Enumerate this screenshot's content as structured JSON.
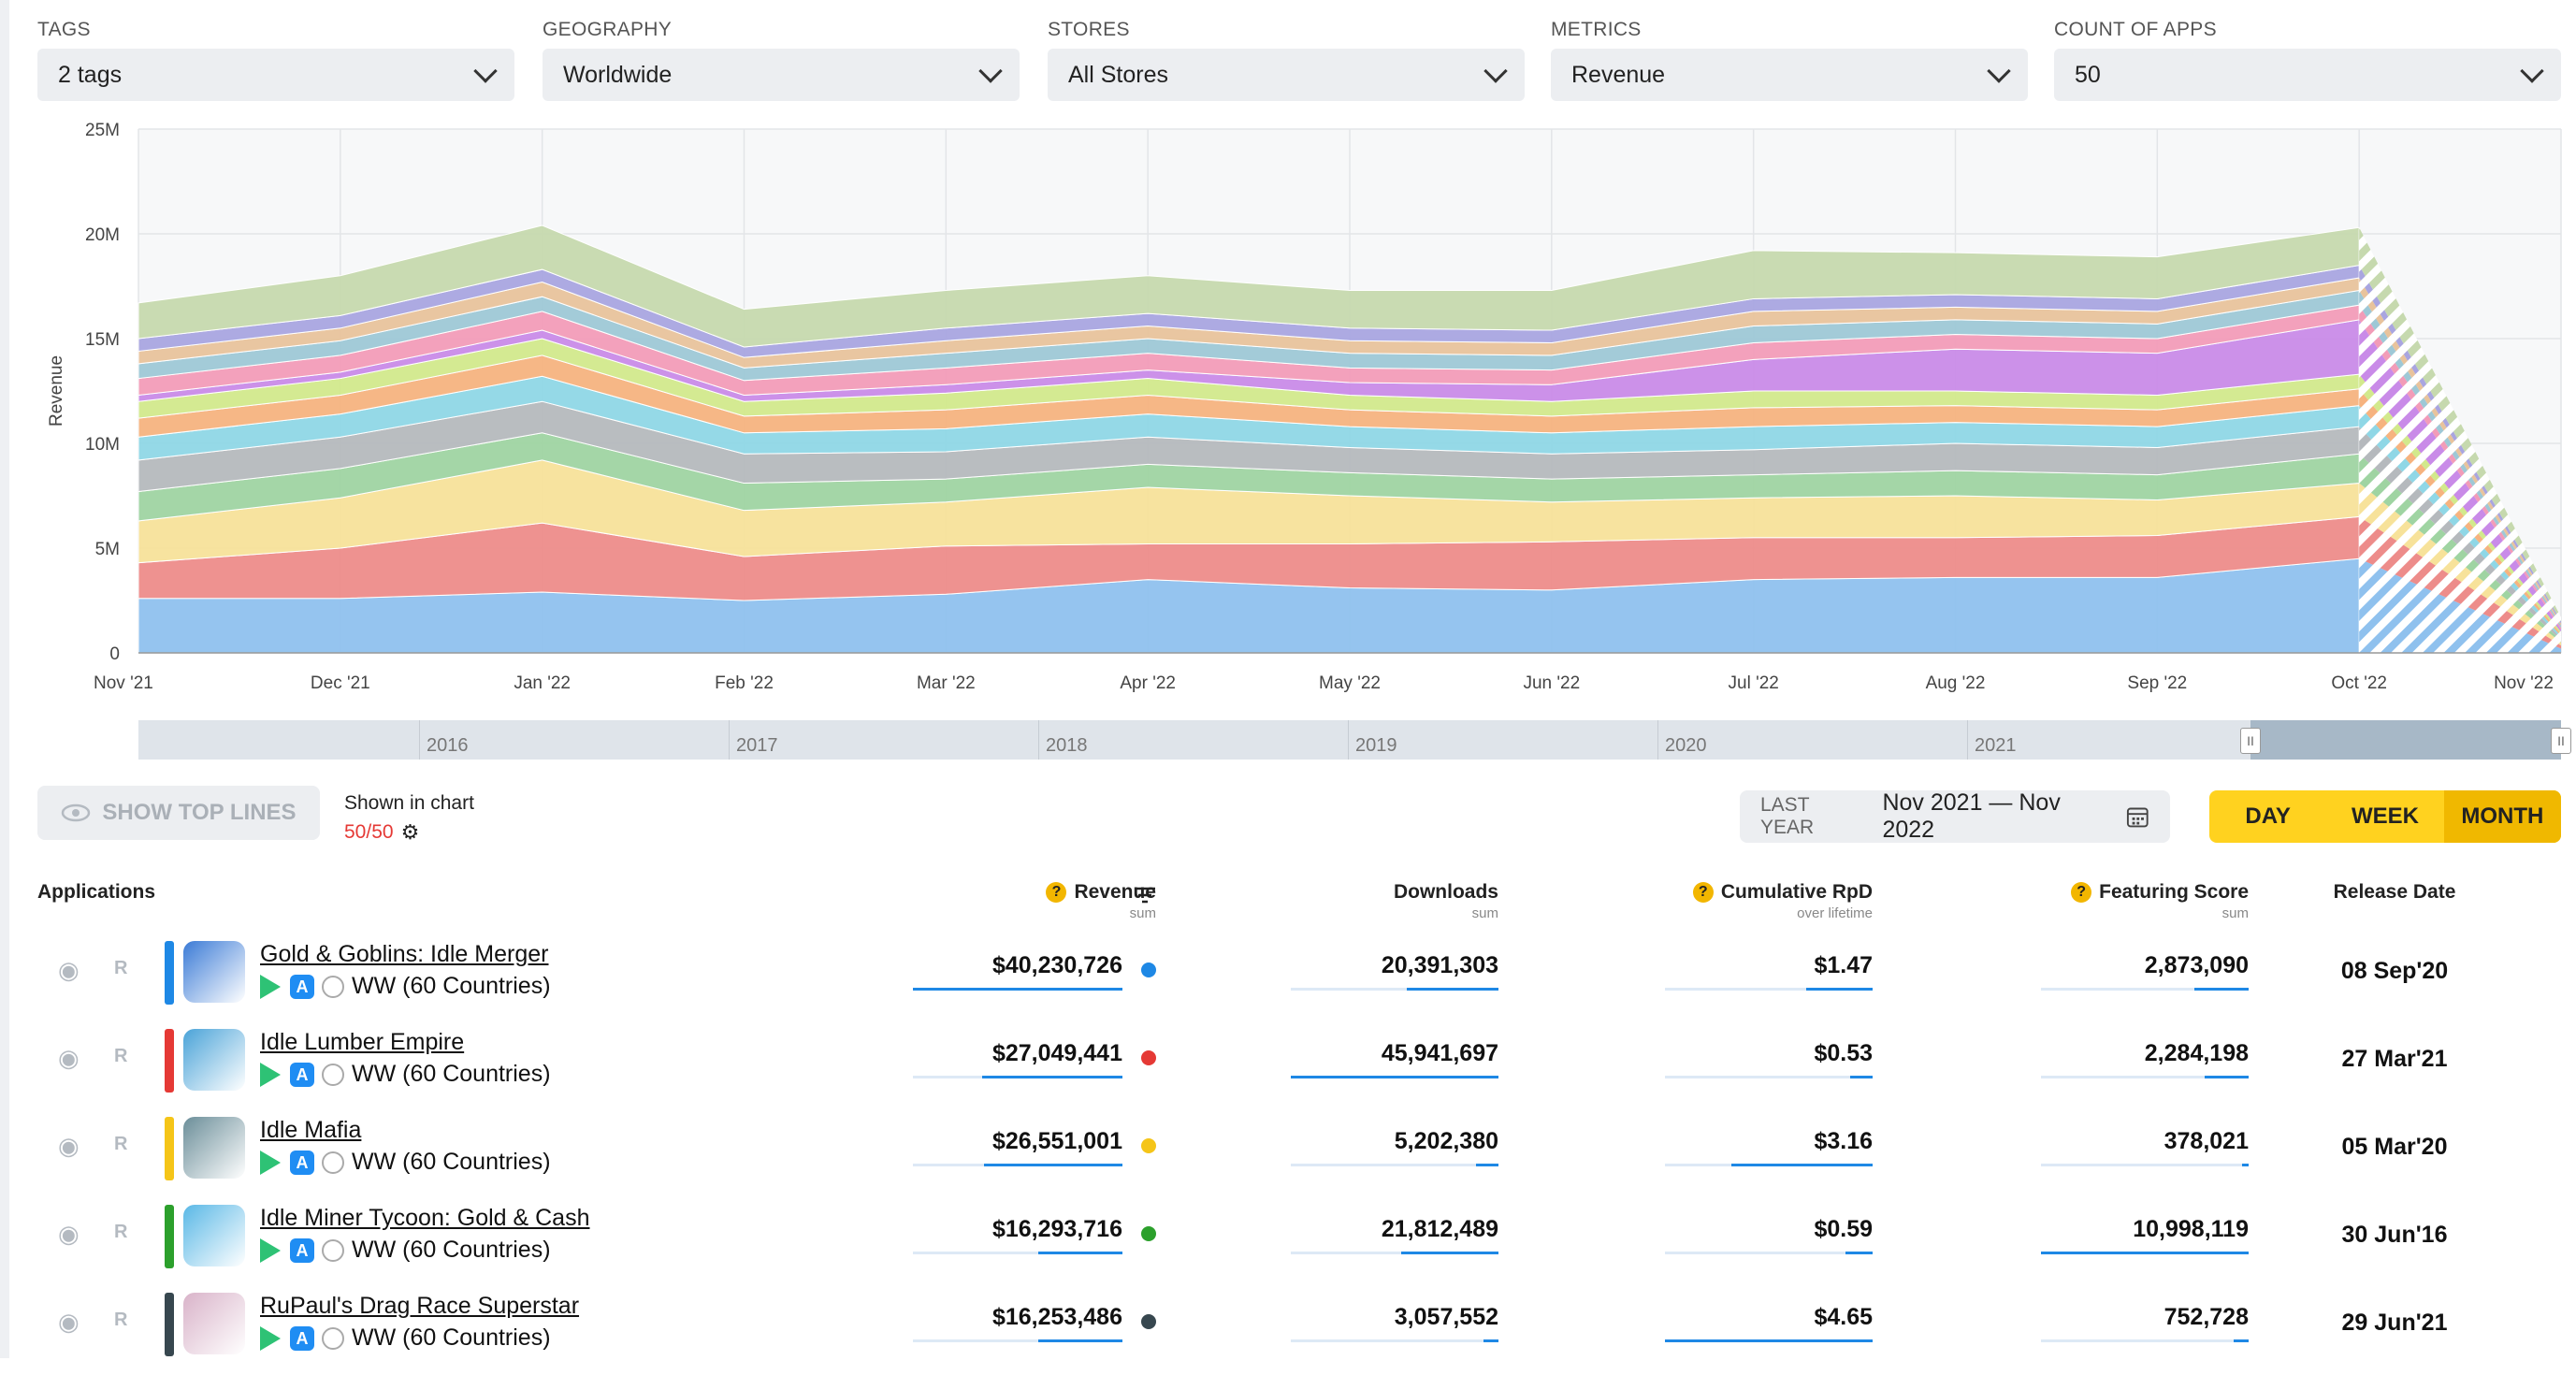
{
  "filters": [
    {
      "label": "TAGS",
      "value": "2 tags"
    },
    {
      "label": "GEOGRAPHY",
      "value": "Worldwide"
    },
    {
      "label": "STORES",
      "value": "All Stores"
    },
    {
      "label": "METRICS",
      "value": "Revenue"
    },
    {
      "label": "COUNT OF APPS",
      "value": "50"
    }
  ],
  "chart_data": {
    "type": "area",
    "stacked": true,
    "ylabel": "Revenue",
    "ylim": [
      0,
      25000000
    ],
    "y_ticks": [
      "0",
      "5M",
      "10M",
      "15M",
      "20M",
      "25M"
    ],
    "x": [
      "Nov '21",
      "Dec '21",
      "Jan '22",
      "Feb '22",
      "Mar '22",
      "Apr '22",
      "May '22",
      "Jun '22",
      "Jul '22",
      "Aug '22",
      "Sep '22",
      "Oct '22",
      "Nov '22"
    ],
    "grid": true,
    "last_point_partial": true,
    "series": [
      {
        "color": "#8fc1ee",
        "values": [
          2600000,
          2600000,
          2900000,
          2500000,
          2800000,
          3500000,
          3100000,
          3000000,
          3500000,
          3600000,
          3600000,
          4500000,
          200000
        ]
      },
      {
        "color": "#ed8c8a",
        "values": [
          1700000,
          2400000,
          3300000,
          2100000,
          2300000,
          1700000,
          2100000,
          2300000,
          2000000,
          1900000,
          2000000,
          2000000,
          150000
        ]
      },
      {
        "color": "#f7e29a",
        "values": [
          2000000,
          2400000,
          3000000,
          2200000,
          2100000,
          2700000,
          2300000,
          1900000,
          1900000,
          2000000,
          1700000,
          1600000,
          150000
        ]
      },
      {
        "color": "#9fd4a2",
        "values": [
          1400000,
          1400000,
          1300000,
          1300000,
          1100000,
          1100000,
          1100000,
          1100000,
          1100000,
          1200000,
          1200000,
          1400000,
          100000
        ]
      },
      {
        "color": "#b5b9bd",
        "values": [
          1500000,
          1500000,
          1500000,
          1400000,
          1300000,
          1300000,
          1200000,
          1200000,
          1200000,
          1300000,
          1300000,
          1300000,
          100000
        ]
      },
      {
        "color": "#8fd7e6",
        "values": [
          1100000,
          1100000,
          1200000,
          1000000,
          1100000,
          1100000,
          1000000,
          1000000,
          1100000,
          1000000,
          1000000,
          1000000,
          100000
        ]
      },
      {
        "color": "#f6b37f",
        "values": [
          900000,
          900000,
          1000000,
          800000,
          900000,
          900000,
          800000,
          800000,
          900000,
          800000,
          800000,
          800000,
          100000
        ]
      },
      {
        "color": "#d2e98c",
        "values": [
          800000,
          800000,
          800000,
          700000,
          800000,
          800000,
          700000,
          700000,
          800000,
          700000,
          700000,
          700000,
          100000
        ]
      },
      {
        "color": "#c98be8",
        "values": [
          300000,
          300000,
          400000,
          300000,
          400000,
          400000,
          600000,
          800000,
          1500000,
          2000000,
          2000000,
          2600000,
          100000
        ]
      },
      {
        "color": "#f29cb8",
        "values": [
          800000,
          800000,
          900000,
          700000,
          800000,
          800000,
          700000,
          700000,
          800000,
          700000,
          700000,
          700000,
          100000
        ]
      },
      {
        "color": "#9ec8d6",
        "values": [
          700000,
          700000,
          700000,
          600000,
          700000,
          700000,
          700000,
          700000,
          800000,
          700000,
          700000,
          700000,
          100000
        ]
      },
      {
        "color": "#e8c39c",
        "values": [
          600000,
          600000,
          700000,
          500000,
          600000,
          600000,
          600000,
          600000,
          700000,
          600000,
          600000,
          600000,
          100000
        ]
      },
      {
        "color": "#a9a5e0",
        "values": [
          600000,
          600000,
          600000,
          500000,
          600000,
          600000,
          600000,
          600000,
          600000,
          600000,
          600000,
          600000,
          100000
        ]
      },
      {
        "color": "#c6d9ae",
        "values": [
          1700000,
          1900000,
          2100000,
          1800000,
          1800000,
          1800000,
          1800000,
          1900000,
          2300000,
          2000000,
          2000000,
          1800000,
          200000
        ]
      }
    ]
  },
  "navigator": {
    "years": [
      "2016",
      "2017",
      "2018",
      "2019",
      "2020",
      "2021"
    ]
  },
  "controls": {
    "show_top_lines": "SHOW TOP LINES",
    "shown_in_chart": "Shown in chart",
    "shown_count": "50/50",
    "range_label": "LAST YEAR",
    "range_value": "Nov 2021 — Nov 2022",
    "granularity": [
      "DAY",
      "WEEK",
      "MONTH"
    ],
    "active_granularity": "MONTH"
  },
  "table": {
    "headers": {
      "applications": "Applications",
      "revenue": "Revenue",
      "revenue_sub": "sum",
      "downloads": "Downloads",
      "downloads_sub": "sum",
      "rpd": "Cumulative RpD",
      "rpd_sub": "over lifetime",
      "featuring": "Featuring Score",
      "featuring_sub": "sum",
      "release": "Release Date"
    },
    "rows": [
      {
        "name": "Gold & Goblins: Idle Merger",
        "region": "WW (60 Countries)",
        "color": "#1e88e5",
        "revenue": "$40,230,726",
        "downloads": "20,391,303",
        "rpd": "$1.47",
        "featuring": "2,873,090",
        "release": "08 Sep'20",
        "revenue_frac": 1.0,
        "downloads_frac": 0.44,
        "rpd_frac": 0.32,
        "featuring_frac": 0.26,
        "icon_color": "#3b7bd6"
      },
      {
        "name": "Idle Lumber Empire",
        "region": "WW (60 Countries)",
        "color": "#e53935",
        "revenue": "$27,049,441",
        "downloads": "45,941,697",
        "rpd": "$0.53",
        "featuring": "2,284,198",
        "release": "27 Mar'21",
        "revenue_frac": 0.67,
        "downloads_frac": 1.0,
        "rpd_frac": 0.11,
        "featuring_frac": 0.21,
        "icon_color": "#4aa3d8"
      },
      {
        "name": "Idle Mafia",
        "region": "WW (60 Countries)",
        "color": "#f5c518",
        "revenue": "$26,551,001",
        "downloads": "5,202,380",
        "rpd": "$3.16",
        "featuring": "378,021",
        "release": "05 Mar'20",
        "revenue_frac": 0.66,
        "downloads_frac": 0.11,
        "rpd_frac": 0.68,
        "featuring_frac": 0.03,
        "icon_color": "#6b8e99"
      },
      {
        "name": "Idle Miner Tycoon: Gold & Cash",
        "region": "WW (60 Countries)",
        "color": "#2ca02c",
        "revenue": "$16,293,716",
        "downloads": "21,812,489",
        "rpd": "$0.59",
        "featuring": "10,998,119",
        "release": "30 Jun'16",
        "revenue_frac": 0.4,
        "downloads_frac": 0.47,
        "rpd_frac": 0.13,
        "featuring_frac": 1.0,
        "icon_color": "#5ab8e6"
      },
      {
        "name": "RuPaul's Drag Race Superstar",
        "region": "WW (60 Countries)",
        "color": "#37474f",
        "revenue": "$16,253,486",
        "downloads": "3,057,552",
        "rpd": "$4.65",
        "featuring": "752,728",
        "release": "29 Jun'21",
        "revenue_frac": 0.4,
        "downloads_frac": 0.07,
        "rpd_frac": 1.0,
        "featuring_frac": 0.07,
        "icon_color": "#d9b3c9"
      }
    ]
  }
}
